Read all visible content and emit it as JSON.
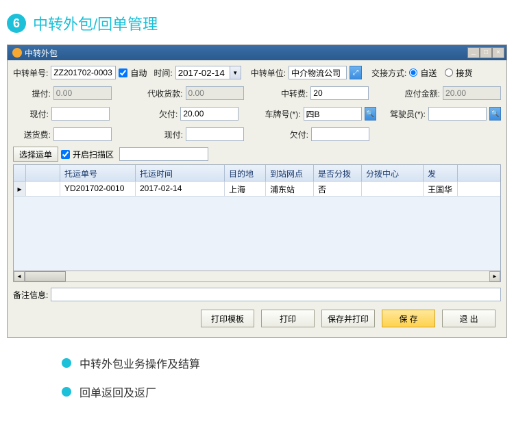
{
  "section": {
    "number": "6",
    "title": "中转外包/回单管理"
  },
  "window": {
    "title": "中转外包",
    "controls": {
      "min": "_",
      "max": "□",
      "close": "×"
    }
  },
  "form": {
    "row1": {
      "orderNo_lbl": "中转单号:",
      "orderNo": "ZZ201702-0003",
      "auto_lbl": "自动",
      "time_lbl": "时间:",
      "time": "2017-02-14",
      "unit_lbl": "中转单位:",
      "unit": "中介物流公司",
      "method_lbl": "交接方式:",
      "opt1": "自送",
      "opt2": "接货"
    },
    "row2": {
      "tifu_lbl": "提付:",
      "tifu": "0.00",
      "dshk_lbl": "代收货款:",
      "dshk": "0.00",
      "zzf_lbl": "中转费:",
      "zzf": "20",
      "yfje_lbl": "应付金额:",
      "yfje": "20.00"
    },
    "row3": {
      "xianfu_lbl": "现付:",
      "xianfu": "",
      "qianfu_lbl": "欠付:",
      "qianfu": "20.00",
      "plate_lbl": "车牌号(*):",
      "plate": "四B",
      "driver_lbl": "驾驶员(*):",
      "driver": ""
    },
    "row4": {
      "shf_lbl": "送货费:",
      "shf": "",
      "xianfu2_lbl": "现付:",
      "xianfu2": "",
      "qianfu2_lbl": "欠付:",
      "qianfu2": ""
    },
    "action": {
      "select_btn": "选择运单",
      "scan_lbl": "开启扫描区"
    }
  },
  "grid": {
    "headers": [
      "",
      "托运单号",
      "托运时间",
      "目的地",
      "到站网点",
      "是否分拨",
      "分拨中心",
      "发"
    ],
    "rows": [
      {
        "orderNo": "YD201702-0010",
        "time": "2017-02-14",
        "dest": "上海",
        "station": "浦东站",
        "fenbo": "否",
        "center": "",
        "ext": "王国华"
      }
    ]
  },
  "remark": {
    "lbl": "备注信息:",
    "val": ""
  },
  "buttons": {
    "tpl": "打印模板",
    "print": "打印",
    "savePrint": "保存并打印",
    "save": "保 存",
    "exit": "退 出"
  },
  "bullets": [
    "中转外包业务操作及结算",
    "回单返回及返厂"
  ]
}
